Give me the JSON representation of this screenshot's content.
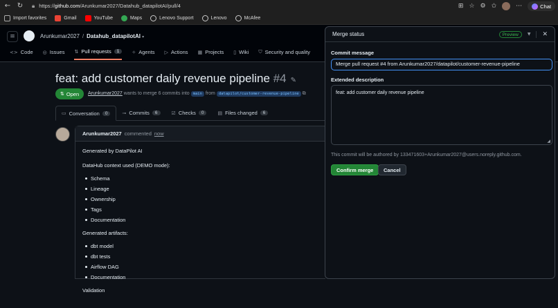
{
  "browser": {
    "url_host": "github.com",
    "url_path": "/Arunkumar2027/Datahub_datapilotAI/pull/4",
    "chat_label": "Chat",
    "bookmarks": [
      "Import favorites",
      "Gmail",
      "YouTube",
      "Maps",
      "Lenovo Support",
      "Lenovo",
      "McAfee"
    ]
  },
  "repo": {
    "owner": "Arunkumar2027",
    "name": "Datahub_datapilotAI",
    "nav": [
      {
        "label": "Code",
        "icon": "code-icon"
      },
      {
        "label": "Issues",
        "icon": "issue-icon"
      },
      {
        "label": "Pull requests",
        "icon": "pull-request-icon",
        "count": "1"
      },
      {
        "label": "Agents",
        "icon": "agents-icon"
      },
      {
        "label": "Actions",
        "icon": "actions-icon"
      },
      {
        "label": "Projects",
        "icon": "projects-icon"
      },
      {
        "label": "Wiki",
        "icon": "wiki-icon"
      },
      {
        "label": "Security and quality",
        "icon": "shield-icon"
      }
    ]
  },
  "pr": {
    "title": "feat: add customer daily revenue pipeline",
    "number": "#4",
    "state": "Open",
    "author": "Arunkumar2027",
    "meta_mid": "wants to merge 6 commits into",
    "base_branch": "main",
    "from_word": "from",
    "head_branch": "datapilot/customer-revenue-pipeline",
    "tabs": [
      {
        "label": "Conversation",
        "count": "0"
      },
      {
        "label": "Commits",
        "count": "6"
      },
      {
        "label": "Checks",
        "count": "0"
      },
      {
        "label": "Files changed",
        "count": "6"
      }
    ]
  },
  "comment": {
    "author": "Arunkumar2027",
    "action": "commented",
    "when": "now",
    "intro": "Generated by DataPilot AI",
    "context_heading": "DataHub context used (DEMO mode):",
    "context_items": [
      "Schema",
      "Lineage",
      "Ownership",
      "Tags",
      "Documentation"
    ],
    "artifacts_heading": "Generated artifacts:",
    "artifacts_items": [
      "dbt model",
      "dbt tests",
      "Airflow DAG",
      "Documentation"
    ],
    "cutoff_text": "Validation"
  },
  "merge_panel": {
    "title": "Merge status",
    "badge": "Preview",
    "commit_label": "Commit message",
    "commit_value": "Merge pull request #4 from Arunkumar2027/datapilot/customer-revenue-pipeline",
    "desc_label": "Extended description",
    "desc_value": "feat: add customer daily revenue pipeline",
    "author_note": "This commit will be authored by 133471603+Arunkumar2027@users.noreply.github.com.",
    "confirm_label": "Confirm merge",
    "cancel_label": "Cancel"
  },
  "colors": {
    "accent_green": "#238636",
    "focus_blue": "#4493f8",
    "background": "#0d1117"
  }
}
